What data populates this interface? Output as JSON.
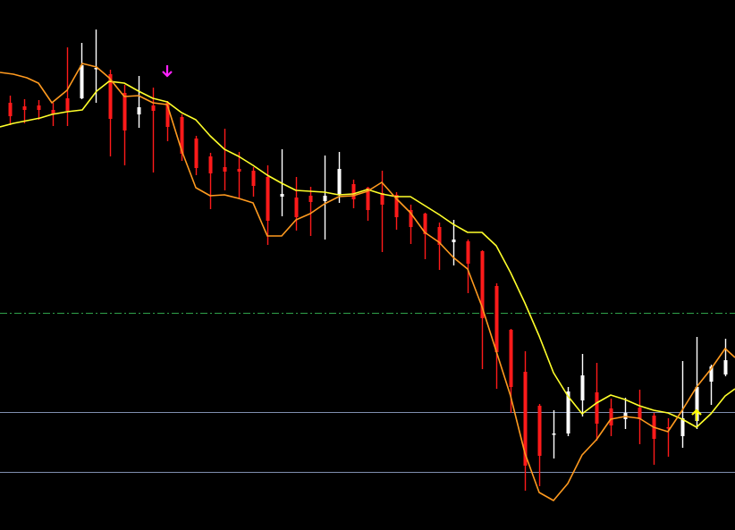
{
  "chart_data": {
    "type": "candlestick",
    "ylim": [
      0,
      593
    ],
    "grid": false,
    "colors": {
      "background": "#000000",
      "bull": "#ffffff",
      "bear": "#ff1a1a",
      "ma_fast": "#ff9a1f",
      "ma_slow": "#ffff2a",
      "level_mid": "#2fa04a",
      "level_low": "#7f8fae",
      "arrow_down": "#ff22ff",
      "arrow_up": "#ffff00"
    },
    "candles": [
      {
        "x": 11,
        "o": 478,
        "c": 463,
        "h": 486,
        "l": 453
      },
      {
        "x": 27,
        "o": 474,
        "c": 470,
        "h": 482,
        "l": 455
      },
      {
        "x": 43,
        "o": 475,
        "c": 470,
        "h": 481,
        "l": 459
      },
      {
        "x": 59,
        "o": 470,
        "c": 466,
        "h": 478,
        "l": 452
      },
      {
        "x": 75,
        "o": 483,
        "c": 469,
        "h": 540,
        "l": 452
      },
      {
        "x": 91,
        "o": 483,
        "c": 520,
        "h": 545,
        "l": 482
      },
      {
        "x": 107,
        "o": 517,
        "c": 517,
        "h": 560,
        "l": 478
      },
      {
        "x": 123,
        "o": 510,
        "c": 460,
        "h": 515,
        "l": 418
      },
      {
        "x": 139,
        "o": 489,
        "c": 447,
        "h": 498,
        "l": 408
      },
      {
        "x": 155,
        "o": 465,
        "c": 473,
        "h": 508,
        "l": 450
      },
      {
        "x": 171,
        "o": 475,
        "c": 469,
        "h": 495,
        "l": 400
      },
      {
        "x": 187,
        "o": 478,
        "c": 451,
        "h": 480,
        "l": 435
      },
      {
        "x": 203,
        "o": 462,
        "c": 421,
        "h": 465,
        "l": 413
      },
      {
        "x": 219,
        "o": 438,
        "c": 405,
        "h": 441,
        "l": 397
      },
      {
        "x": 235,
        "o": 418,
        "c": 399,
        "h": 422,
        "l": 359
      },
      {
        "x": 251,
        "o": 406,
        "c": 401,
        "h": 449,
        "l": 380
      },
      {
        "x": 267,
        "o": 404,
        "c": 401,
        "h": 423,
        "l": 370
      },
      {
        "x": 283,
        "o": 402,
        "c": 385,
        "h": 406,
        "l": 373
      },
      {
        "x": 299,
        "o": 395,
        "c": 346,
        "h": 408,
        "l": 319
      },
      {
        "x": 315,
        "o": 373,
        "c": 376,
        "h": 426,
        "l": 351
      },
      {
        "x": 331,
        "o": 372,
        "c": 350,
        "h": 395,
        "l": 335
      },
      {
        "x": 347,
        "o": 374,
        "c": 367,
        "h": 384,
        "l": 329
      },
      {
        "x": 363,
        "o": 368,
        "c": 374,
        "h": 419,
        "l": 325
      },
      {
        "x": 379,
        "o": 375,
        "c": 404,
        "h": 423,
        "l": 366
      },
      {
        "x": 395,
        "o": 387,
        "c": 370,
        "h": 392,
        "l": 360
      },
      {
        "x": 411,
        "o": 383,
        "c": 358,
        "h": 384,
        "l": 346
      },
      {
        "x": 427,
        "o": 377,
        "c": 364,
        "h": 402,
        "l": 311
      },
      {
        "x": 443,
        "o": 375,
        "c": 350,
        "h": 378,
        "l": 336
      },
      {
        "x": 459,
        "o": 358,
        "c": 339,
        "h": 364,
        "l": 320
      },
      {
        "x": 475,
        "o": 354,
        "c": 331,
        "h": 355,
        "l": 303
      },
      {
        "x": 491,
        "o": 339,
        "c": 319,
        "h": 344,
        "l": 291
      },
      {
        "x": 507,
        "o": 322,
        "c": 325,
        "h": 347,
        "l": 296
      },
      {
        "x": 523,
        "o": 323,
        "c": 298,
        "h": 325,
        "l": 265
      },
      {
        "x": 539,
        "o": 312,
        "c": 237,
        "h": 313,
        "l": 180
      },
      {
        "x": 555,
        "o": 273,
        "c": 199,
        "h": 276,
        "l": 158
      },
      {
        "x": 571,
        "o": 224,
        "c": 160,
        "h": 225,
        "l": 131
      },
      {
        "x": 587,
        "o": 177,
        "c": 72,
        "h": 200,
        "l": 44
      },
      {
        "x": 603,
        "o": 139,
        "c": 83,
        "h": 141,
        "l": 49
      },
      {
        "x": 619,
        "o": 108,
        "c": 108,
        "h": 134,
        "l": 80
      },
      {
        "x": 635,
        "o": 108,
        "c": 155,
        "h": 160,
        "l": 105
      },
      {
        "x": 651,
        "o": 145,
        "c": 173,
        "h": 197,
        "l": 127
      },
      {
        "x": 667,
        "o": 154,
        "c": 119,
        "h": 187,
        "l": 100
      },
      {
        "x": 683,
        "o": 136,
        "c": 117,
        "h": 147,
        "l": 105
      },
      {
        "x": 699,
        "o": 124,
        "c": 131,
        "h": 148,
        "l": 113
      },
      {
        "x": 715,
        "o": 137,
        "c": 124,
        "h": 157,
        "l": 96
      },
      {
        "x": 731,
        "o": 128,
        "c": 102,
        "h": 131,
        "l": 73
      },
      {
        "x": 747,
        "o": 115,
        "c": 114,
        "h": 125,
        "l": 82
      },
      {
        "x": 763,
        "o": 105,
        "c": 125,
        "h": 189,
        "l": 92
      },
      {
        "x": 779,
        "o": 122,
        "c": 160,
        "h": 216,
        "l": 113
      },
      {
        "x": 795,
        "o": 166,
        "c": 183,
        "h": 185,
        "l": 140
      },
      {
        "x": 811,
        "o": 174,
        "c": 190,
        "h": 214,
        "l": 172
      }
    ],
    "ma_fast": [
      [
        0,
        512
      ],
      [
        15,
        510
      ],
      [
        30,
        506
      ],
      [
        43,
        500
      ],
      [
        58,
        478
      ],
      [
        75,
        492
      ],
      [
        92,
        522
      ],
      [
        108,
        518
      ],
      [
        122,
        506
      ],
      [
        139,
        485
      ],
      [
        155,
        486
      ],
      [
        171,
        478
      ],
      [
        187,
        476
      ],
      [
        203,
        425
      ],
      [
        219,
        383
      ],
      [
        235,
        374
      ],
      [
        251,
        375
      ],
      [
        267,
        371
      ],
      [
        283,
        366
      ],
      [
        299,
        329
      ],
      [
        315,
        329
      ],
      [
        331,
        347
      ],
      [
        347,
        354
      ],
      [
        363,
        365
      ],
      [
        379,
        373
      ],
      [
        395,
        374
      ],
      [
        411,
        379
      ],
      [
        427,
        389
      ],
      [
        443,
        371
      ],
      [
        459,
        355
      ],
      [
        475,
        333
      ],
      [
        491,
        322
      ],
      [
        507,
        305
      ],
      [
        523,
        292
      ],
      [
        539,
        250
      ],
      [
        555,
        200
      ],
      [
        571,
        150
      ],
      [
        587,
        86
      ],
      [
        603,
        42
      ],
      [
        619,
        33
      ],
      [
        635,
        52
      ],
      [
        651,
        84
      ],
      [
        667,
        101
      ],
      [
        683,
        124
      ],
      [
        699,
        127
      ],
      [
        715,
        125
      ],
      [
        731,
        115
      ],
      [
        747,
        110
      ],
      [
        763,
        134
      ],
      [
        779,
        160
      ],
      [
        795,
        180
      ],
      [
        811,
        203
      ],
      [
        822,
        193
      ]
    ],
    "ma_slow": [
      [
        0,
        451
      ],
      [
        15,
        455
      ],
      [
        30,
        458
      ],
      [
        45,
        461
      ],
      [
        58,
        465
      ],
      [
        75,
        468
      ],
      [
        92,
        470
      ],
      [
        108,
        491
      ],
      [
        122,
        502
      ],
      [
        139,
        500
      ],
      [
        155,
        491
      ],
      [
        171,
        483
      ],
      [
        187,
        479
      ],
      [
        203,
        467
      ],
      [
        219,
        459
      ],
      [
        235,
        441
      ],
      [
        251,
        426
      ],
      [
        267,
        418
      ],
      [
        283,
        408
      ],
      [
        299,
        397
      ],
      [
        315,
        388
      ],
      [
        331,
        380
      ],
      [
        347,
        379
      ],
      [
        363,
        378
      ],
      [
        379,
        375
      ],
      [
        395,
        376
      ],
      [
        411,
        381
      ],
      [
        427,
        376
      ],
      [
        443,
        373
      ],
      [
        459,
        373
      ],
      [
        475,
        363
      ],
      [
        491,
        353
      ],
      [
        507,
        342
      ],
      [
        523,
        333
      ],
      [
        539,
        333
      ],
      [
        555,
        318
      ],
      [
        571,
        288
      ],
      [
        587,
        254
      ],
      [
        603,
        217
      ],
      [
        619,
        176
      ],
      [
        635,
        150
      ],
      [
        651,
        130
      ],
      [
        667,
        142
      ],
      [
        683,
        151
      ],
      [
        699,
        146
      ],
      [
        715,
        139
      ],
      [
        731,
        134
      ],
      [
        747,
        131
      ],
      [
        763,
        124
      ],
      [
        779,
        115
      ],
      [
        795,
        130
      ],
      [
        811,
        150
      ],
      [
        822,
        158
      ]
    ],
    "levels": [
      {
        "y": 243,
        "style": "dashdot",
        "color_key": "level_mid"
      },
      {
        "y": 132,
        "style": "solid",
        "color_key": "level_low"
      },
      {
        "y": 65,
        "style": "solid",
        "color_key": "level_low"
      }
    ],
    "signals": [
      {
        "type": "sell",
        "x": 187,
        "y": 514
      },
      {
        "type": "buy",
        "x": 779,
        "y": 128
      }
    ]
  }
}
